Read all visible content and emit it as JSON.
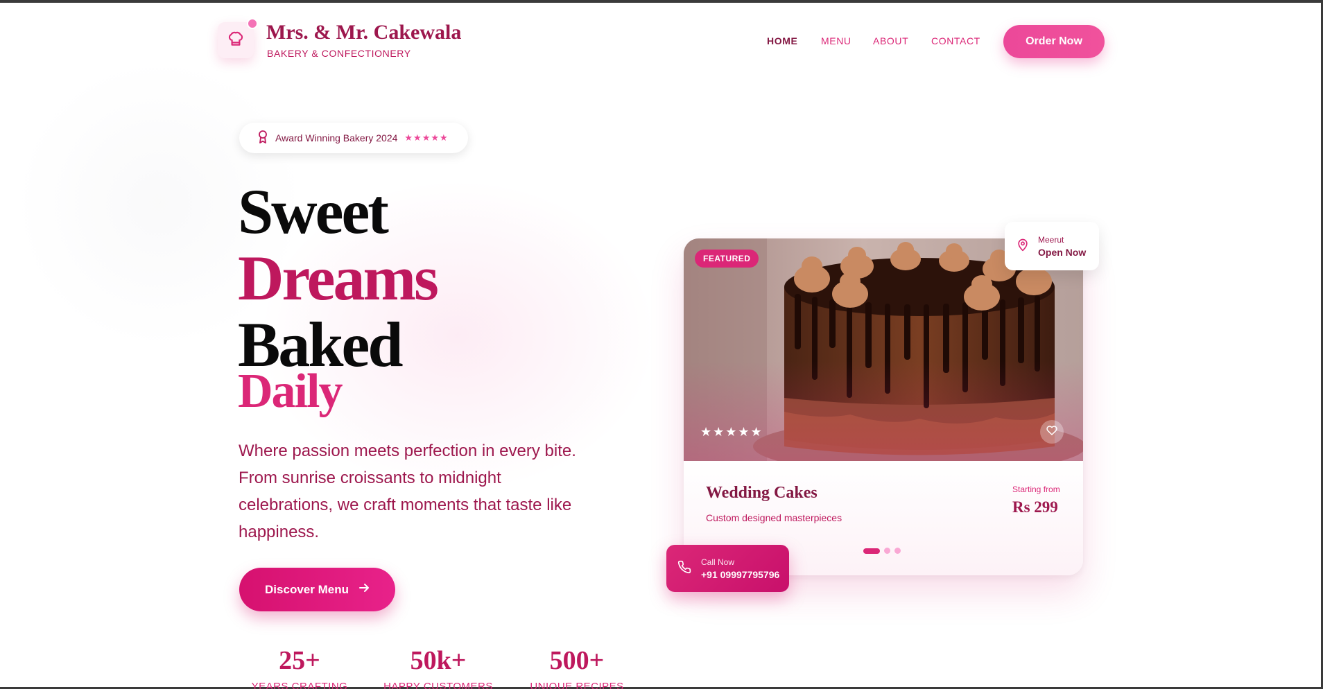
{
  "brand": {
    "name": "Mrs. & Mr. Cakewala",
    "tagline": "BAKERY & CONFECTIONERY",
    "logo_icon": "chef-hat-icon"
  },
  "nav": {
    "items": [
      {
        "label": "HOME",
        "active": true
      },
      {
        "label": "MENU",
        "active": false
      },
      {
        "label": "ABOUT",
        "active": false
      },
      {
        "label": "CONTACT",
        "active": false
      }
    ],
    "cta": "Order Now"
  },
  "hero": {
    "badge": {
      "icon": "award-ribbon-icon",
      "text": "Award Winning Bakery 2024",
      "stars": "★★★★★"
    },
    "headline": [
      "Sweet",
      "Dreams",
      "Baked",
      "Daily"
    ],
    "description": "Where passion meets perfection in every bite. From sunrise croissants to midnight celebrations, we craft moments that taste like happiness.",
    "cta": "Discover Menu"
  },
  "stats": [
    {
      "value": "25+",
      "label": "YEARS CRAFTING"
    },
    {
      "value": "50k+",
      "label": "HAPPY CUSTOMERS"
    },
    {
      "value": "500+",
      "label": "UNIQUE RECIPES"
    }
  ],
  "featured_card": {
    "badge": "FEATURED",
    "stars": "★★★★★",
    "title": "Wedding Cakes",
    "subtitle": "Custom designed masterpieces",
    "price_label": "Starting from",
    "price": "Rs 299",
    "carousel": {
      "count": 3,
      "active": 1
    }
  },
  "location": {
    "city": "Meerut",
    "status": "Open Now"
  },
  "call": {
    "label": "Call Now",
    "number": "+91 09997795796"
  },
  "colors": {
    "primary": "#db2777",
    "deep": "#831843",
    "accent": "#ec4899"
  }
}
